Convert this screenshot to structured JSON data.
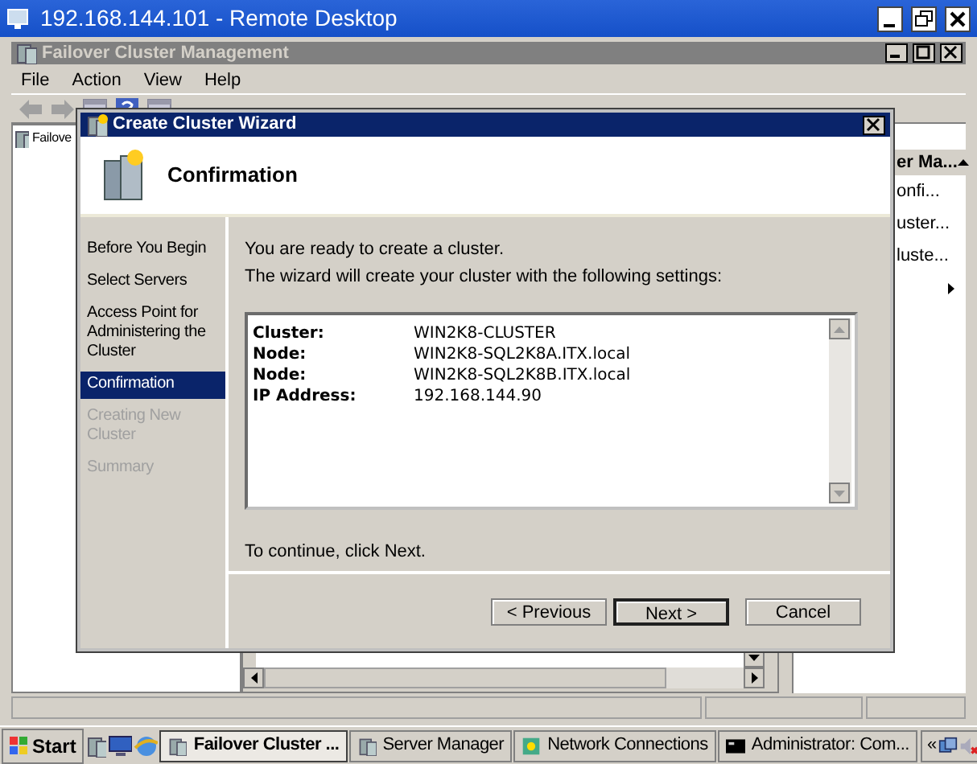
{
  "remote_desktop": {
    "title": "192.168.144.101 - Remote Desktop"
  },
  "mmc": {
    "title": "Failover Cluster Management",
    "menu": [
      "File",
      "Action",
      "View",
      "Help"
    ],
    "tree": [
      "Failove"
    ],
    "actions": {
      "header": "er Ma...",
      "items": [
        "onfi...",
        "uster...",
        "luste..."
      ]
    }
  },
  "wizard": {
    "title": "Create Cluster Wizard",
    "heading": "Confirmation",
    "steps": [
      {
        "label": "Before You Begin",
        "selected": false,
        "disabled": false
      },
      {
        "label": "Select Servers",
        "selected": false,
        "disabled": false
      },
      {
        "label": "Access Point for Administering the Cluster",
        "selected": false,
        "disabled": false
      },
      {
        "label": "Confirmation",
        "selected": true,
        "disabled": false
      },
      {
        "label": "Creating New Cluster",
        "selected": false,
        "disabled": true
      },
      {
        "label": "Summary",
        "selected": false,
        "disabled": true
      }
    ],
    "intro": [
      "You are ready to create a cluster.",
      "The wizard will create your cluster with the following settings:"
    ],
    "settings": [
      {
        "label": "Cluster:",
        "value": "WIN2K8-CLUSTER"
      },
      {
        "label": "Node:",
        "value": "WIN2K8-SQL2K8A.ITX.local"
      },
      {
        "label": "Node:",
        "value": "WIN2K8-SQL2K8B.ITX.local"
      },
      {
        "label": "IP Address:",
        "value": "192.168.144.90"
      }
    ],
    "note": "To continue, click Next.",
    "buttons": [
      {
        "label": "< Previous",
        "default": false
      },
      {
        "label": "Next >",
        "default": true
      },
      {
        "label": "Cancel",
        "default": false
      }
    ]
  },
  "taskbar": {
    "start": "Start",
    "tasks": [
      {
        "label": "Failover Cluster ...",
        "selected": true
      },
      {
        "label": "Server Manager",
        "selected": false
      },
      {
        "label": "Network Connections",
        "selected": false
      },
      {
        "label": "Administrator: Com...",
        "selected": false
      }
    ],
    "chevron": "«"
  }
}
